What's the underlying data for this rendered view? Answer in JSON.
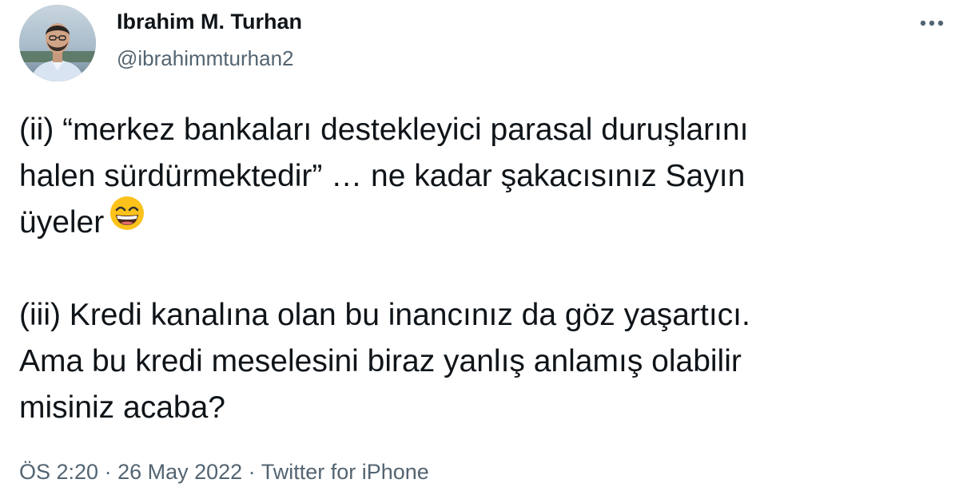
{
  "author": {
    "name": "Ibrahim M. Turhan",
    "handle": "@ibrahimmturhan2"
  },
  "tweet": {
    "para1": "(ii) “merkez bankaları destekleyici parasal duruşlarını\nhalen sürdürmektedir” … ne kadar şakacısınız Sayın\nüyeler",
    "para1_emoji": "grinning-face-with-smiling-eyes-emoji",
    "para2": "(iii) Kredi kanalına olan bu inancınız da göz yaşartıcı.\nAma bu kredi meselesini biraz yanlış anlamış olabilir\nmisiniz acaba?"
  },
  "meta": {
    "time": "ÖS 2:20",
    "date": "26 May 2022",
    "separator": " · ",
    "source": "Twitter for iPhone"
  },
  "icons": {
    "more": "more-horizontal-icon"
  },
  "colors": {
    "text": "#0f1419",
    "secondary": "#536471",
    "emoji": "#fcc21b"
  }
}
